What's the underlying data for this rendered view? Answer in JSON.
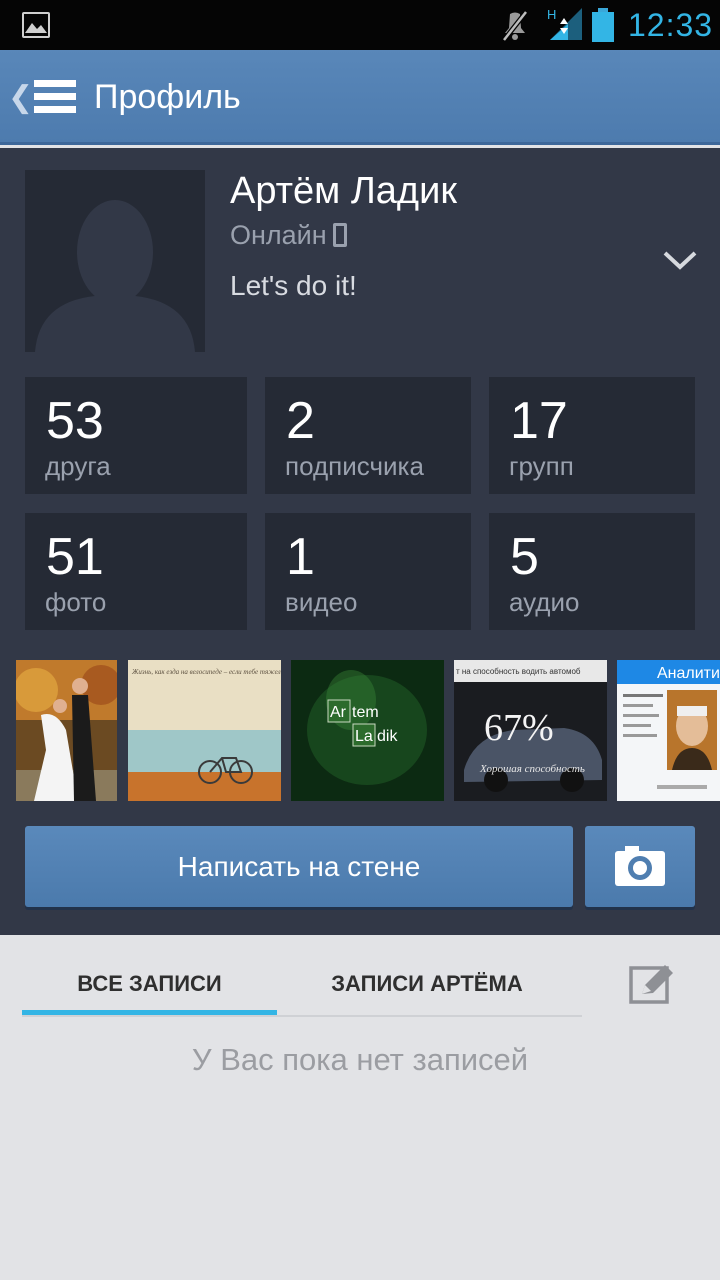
{
  "status_bar": {
    "time": "12:33",
    "network_type": "H",
    "icons": [
      "image-notification-icon",
      "mute-icon",
      "signal-icon",
      "battery-icon"
    ],
    "accent_color": "#33b5e5"
  },
  "action_bar": {
    "title": "Профиль",
    "icons": [
      "back-icon",
      "menu-icon"
    ],
    "color": "#5582b4"
  },
  "profile": {
    "name": "Артём Ладик",
    "online": "Онлайн",
    "status": "Let's do it!",
    "icons": [
      "avatar-placeholder",
      "mobile-icon",
      "chevron-down-icon"
    ]
  },
  "stats": [
    {
      "count": "53",
      "label": "друга"
    },
    {
      "count": "2",
      "label": "подписчика"
    },
    {
      "count": "17",
      "label": "групп"
    },
    {
      "count": "51",
      "label": "фото"
    },
    {
      "count": "1",
      "label": "видео"
    },
    {
      "count": "5",
      "label": "аудио"
    }
  ],
  "photos": {
    "items": [
      {
        "kind": "wedding-photo"
      },
      {
        "kind": "bicycle-quote",
        "caption": "Жизнь, как езда на велосипеде – если тебе тяжело, значит ты едешь на подъём"
      },
      {
        "kind": "name-art",
        "line1_a": "Ar",
        "line1_b": "tem",
        "line2_a": "La",
        "line2_b": "dik"
      },
      {
        "kind": "car-percent",
        "header": "т на способность водить автомоб",
        "percent": "67%",
        "subtitle": "Хорошая способность"
      },
      {
        "kind": "portrait-app",
        "header": "Аналити"
      }
    ]
  },
  "actions": {
    "wall_button": "Написать на стене",
    "camera_icon": "camera-icon"
  },
  "wall": {
    "tabs": [
      "ВСЕ ЗАПИСИ",
      "ЗАПИСИ АРТЁМА"
    ],
    "active_tab": 0,
    "empty_text": "У Вас пока нет записей",
    "edit_icon": "edit-icon"
  }
}
